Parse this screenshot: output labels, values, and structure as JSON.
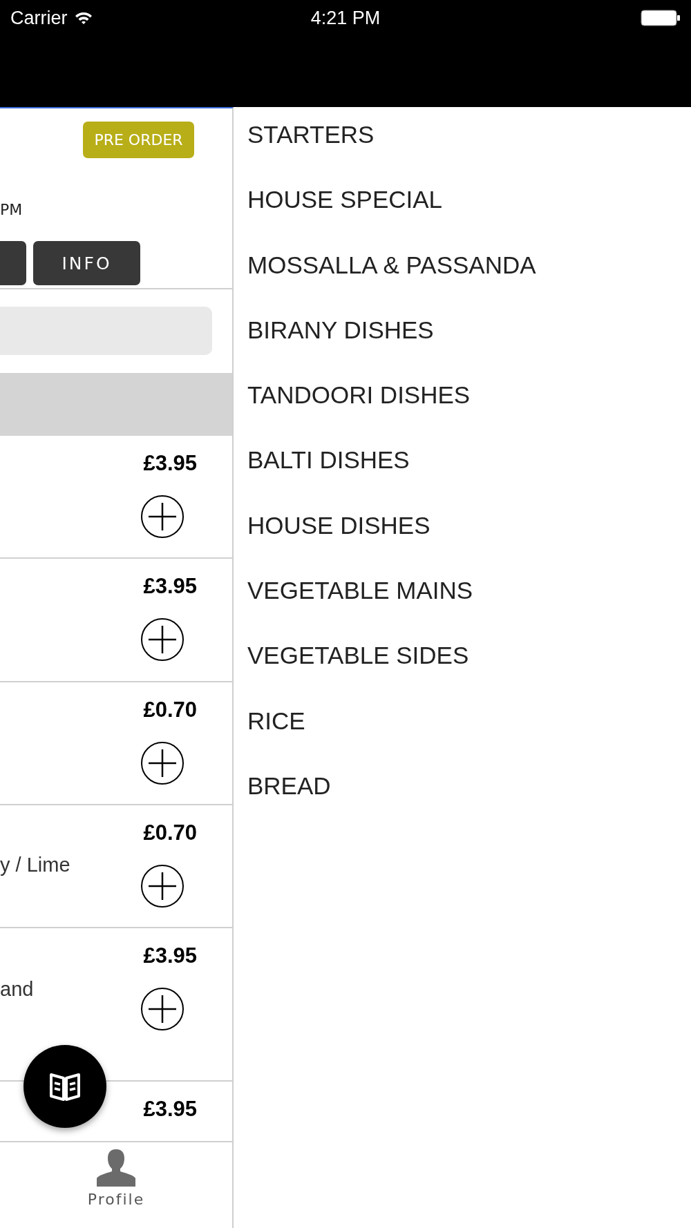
{
  "status_bar": {
    "carrier": "Carrier",
    "time": "4:21 PM"
  },
  "left_panel": {
    "pre_order_button": "PRE ORDER",
    "hours_text": "PM",
    "info_tab": "INFO",
    "items": [
      {
        "price": "£3.95"
      },
      {
        "price": "£3.95"
      },
      {
        "price": "£0.70"
      },
      {
        "price": "£0.70",
        "description": "y / Lime"
      },
      {
        "price": "£3.95",
        "description": "and"
      },
      {
        "price": "£3.95"
      }
    ],
    "tab_bar": [
      {
        "label": "Profile"
      }
    ]
  },
  "categories": [
    "STARTERS",
    "HOUSE SPECIAL",
    "MOSSALLA & PASSANDA",
    "BIRANY DISHES",
    "TANDOORI DISHES",
    "BALTI DISHES",
    "HOUSE DISHES",
    "VEGETABLE MAINS",
    "VEGETABLE SIDES",
    "RICE",
    "BREAD"
  ]
}
